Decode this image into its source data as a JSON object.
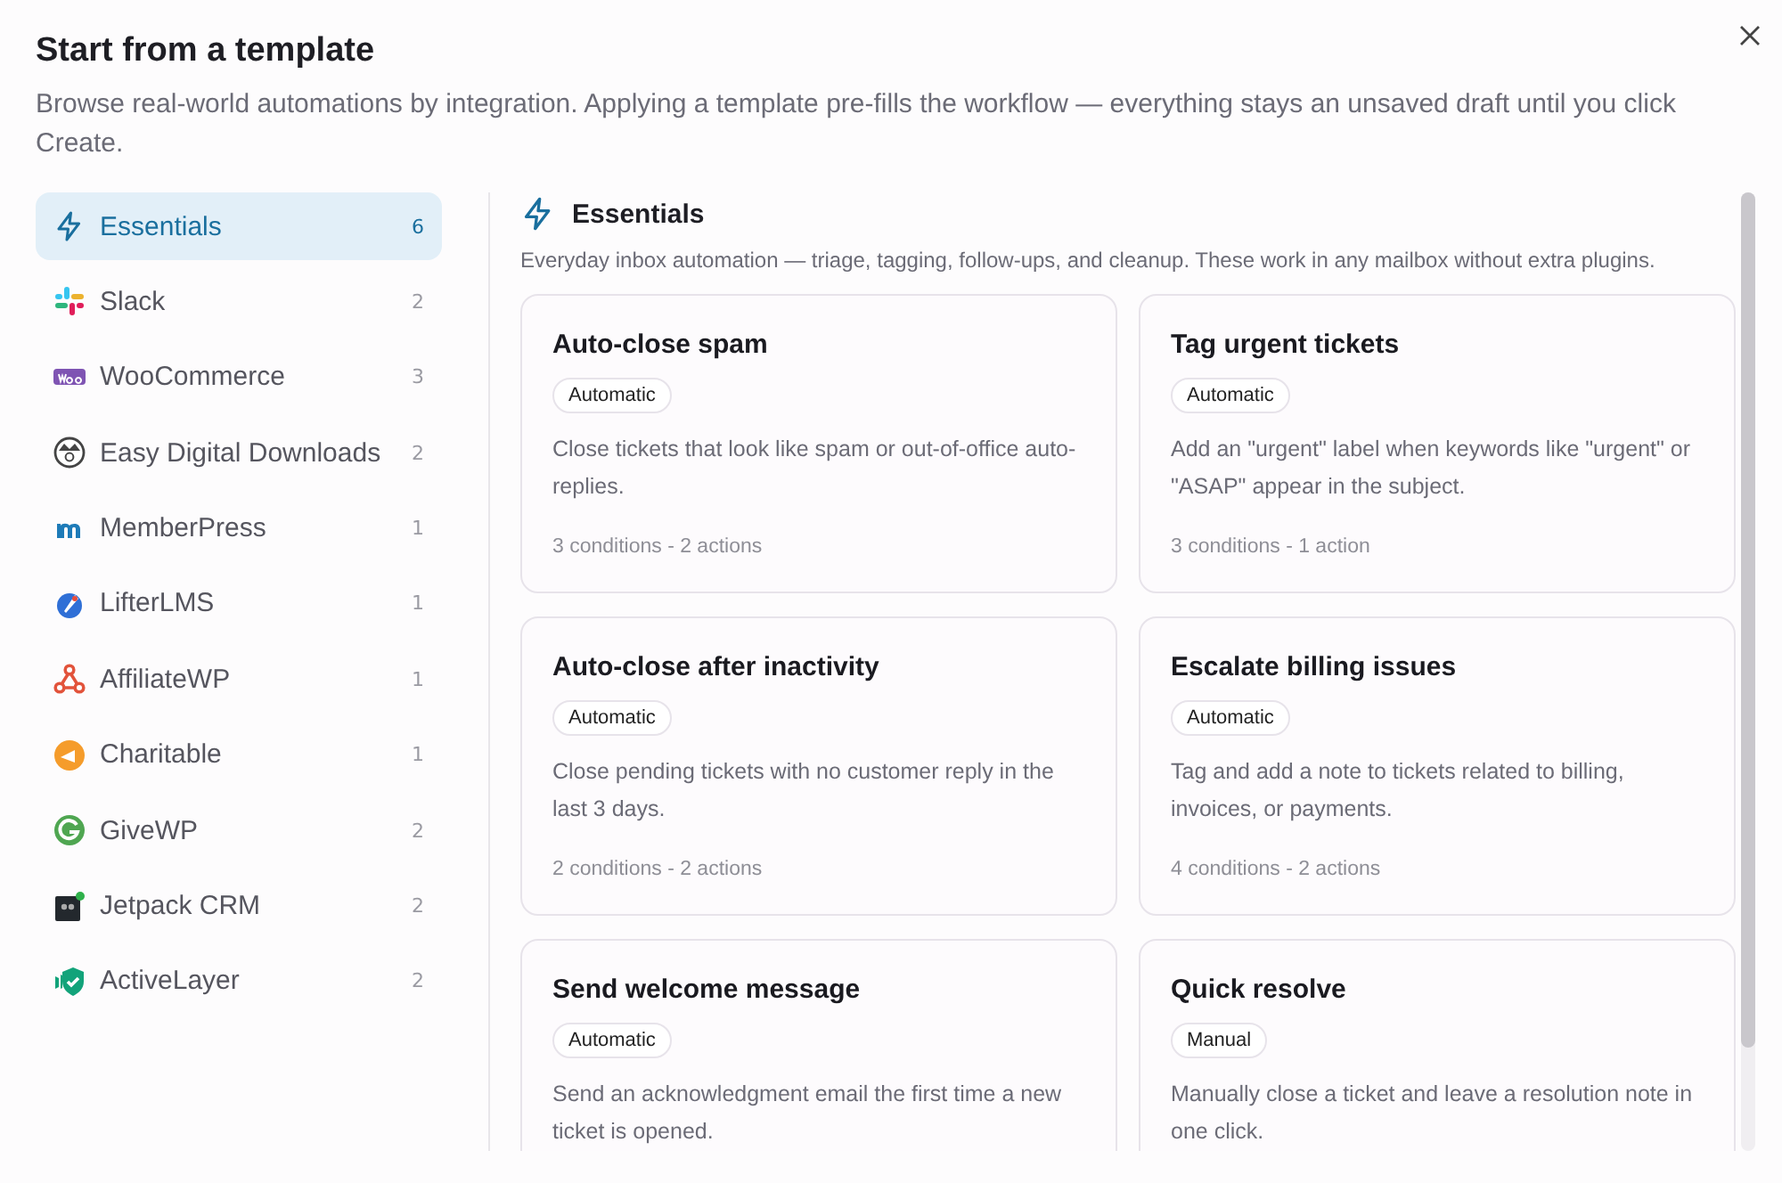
{
  "dialog": {
    "title": "Start from a template",
    "description": "Browse real-world automations by integration. Applying a template pre-fills the workflow — everything stays an unsaved draft until you click Create."
  },
  "sidebar": {
    "items": [
      {
        "label": "Essentials",
        "count": "6",
        "selected": true,
        "kind": "bolt"
      },
      {
        "label": "Slack",
        "count": "2",
        "selected": false,
        "kind": "slack"
      },
      {
        "label": "WooCommerce",
        "count": "3",
        "selected": false,
        "kind": "woo"
      },
      {
        "label": "Easy Digital Downloads",
        "count": "2",
        "selected": false,
        "kind": "edd"
      },
      {
        "label": "MemberPress",
        "count": "1",
        "selected": false,
        "kind": "memberpress"
      },
      {
        "label": "LifterLMS",
        "count": "1",
        "selected": false,
        "kind": "lifter"
      },
      {
        "label": "AffiliateWP",
        "count": "1",
        "selected": false,
        "kind": "affiliate"
      },
      {
        "label": "Charitable",
        "count": "1",
        "selected": false,
        "kind": "charitable"
      },
      {
        "label": "GiveWP",
        "count": "2",
        "selected": false,
        "kind": "give"
      },
      {
        "label": "Jetpack CRM",
        "count": "2",
        "selected": false,
        "kind": "jetpack"
      },
      {
        "label": "ActiveLayer",
        "count": "2",
        "selected": false,
        "kind": "shield"
      }
    ]
  },
  "section": {
    "title": "Essentials",
    "description": "Everyday inbox automation — triage, tagging, follow-ups, and cleanup. These work in any mailbox without extra plugins.",
    "templates": [
      {
        "title": "Auto-close spam",
        "mode": "Automatic",
        "description": "Close tickets that look like spam or out-of-office auto-replies.",
        "summary": "3 conditions - 2 actions"
      },
      {
        "title": "Tag urgent tickets",
        "mode": "Automatic",
        "description": "Add an \"urgent\" label when keywords like \"urgent\" or \"ASAP\" appear in the subject.",
        "summary": "3 conditions - 1 action"
      },
      {
        "title": "Auto-close after inactivity",
        "mode": "Automatic",
        "description": "Close pending tickets with no customer reply in the last 3 days.",
        "summary": "2 conditions - 2 actions"
      },
      {
        "title": "Escalate billing issues",
        "mode": "Automatic",
        "description": "Tag and add a note to tickets related to billing, invoices, or payments.",
        "summary": "4 conditions - 2 actions"
      },
      {
        "title": "Send welcome message",
        "mode": "Automatic",
        "description": "Send an acknowledgment email the first time a new ticket is opened."
      },
      {
        "title": "Quick resolve",
        "mode": "Manual",
        "description": "Manually close a ticket and leave a resolution note in one click."
      }
    ]
  }
}
